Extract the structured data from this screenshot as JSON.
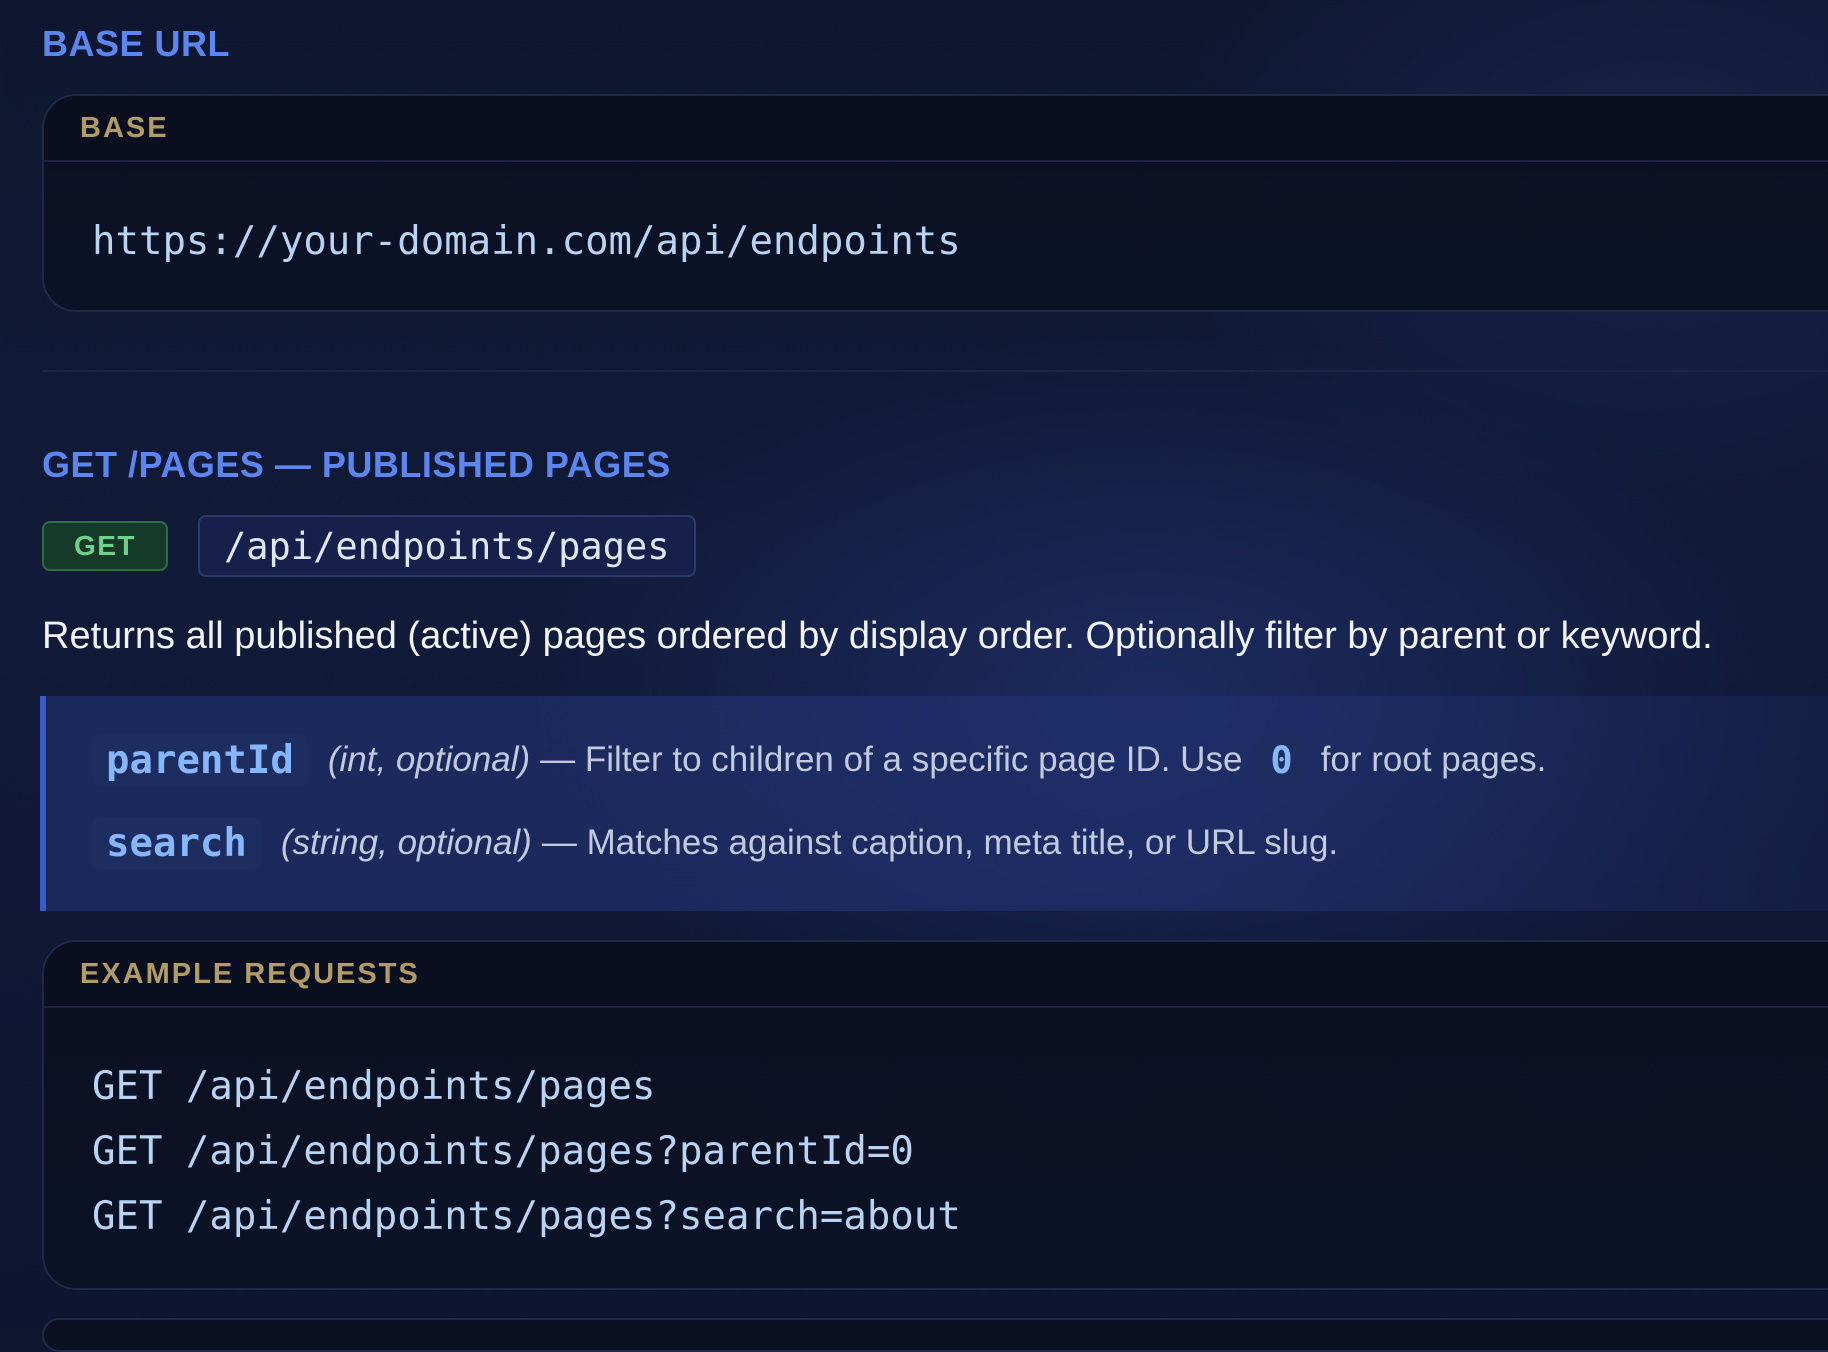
{
  "base_section": {
    "heading": "BASE URL",
    "card_label": "BASE",
    "url": "https://your-domain.com/api/endpoints"
  },
  "pages_section": {
    "heading": "GET /PAGES — PUBLISHED PAGES",
    "method": "GET",
    "path": "/api/endpoints/pages",
    "description": "Returns all published (active) pages ordered by display order. Optionally filter by parent or keyword.",
    "params": [
      {
        "name": "parentId",
        "type": "(int, optional)",
        "desc_before": "— Filter to children of a specific page ID. Use",
        "inline_code": "0",
        "desc_after": "for root pages."
      },
      {
        "name": "search",
        "type": "(string, optional)",
        "desc": "— Matches against caption, meta title, or URL slug."
      }
    ],
    "examples": {
      "label": "EXAMPLE REQUESTS",
      "lines": [
        "GET /api/endpoints/pages",
        "GET /api/endpoints/pages?parentId=0",
        "GET /api/endpoints/pages?search=about"
      ]
    }
  },
  "colors": {
    "heading": "#5b86f0",
    "card_label": "#b39b66",
    "method_get": "#6fd18a",
    "code_text": "#b9d3f2",
    "param_name": "#86b6ff",
    "accent_border": "#3a5cc8"
  }
}
